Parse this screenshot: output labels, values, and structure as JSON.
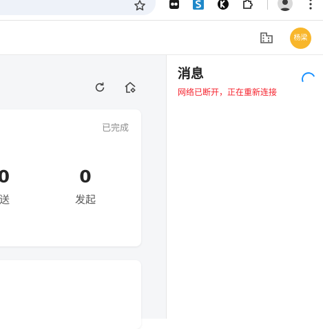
{
  "browser": {
    "icons": [
      "star-icon",
      "extension-icon-1",
      "extension-icon-2",
      "extension-icon-3",
      "puzzle-extensions-icon",
      "profile-avatar",
      "kebab-menu-icon"
    ]
  },
  "header": {
    "user_avatar_text": "杨梁",
    "avatar_color": "#f8b62b"
  },
  "main": {
    "card": {
      "status_label": "已完成",
      "stats": [
        {
          "value": "0",
          "label": "送"
        },
        {
          "value": "0",
          "label": "发起"
        }
      ]
    }
  },
  "messages": {
    "title": "消息",
    "error": "网络已断开，正在重新连接",
    "error_color": "#f5222d"
  }
}
